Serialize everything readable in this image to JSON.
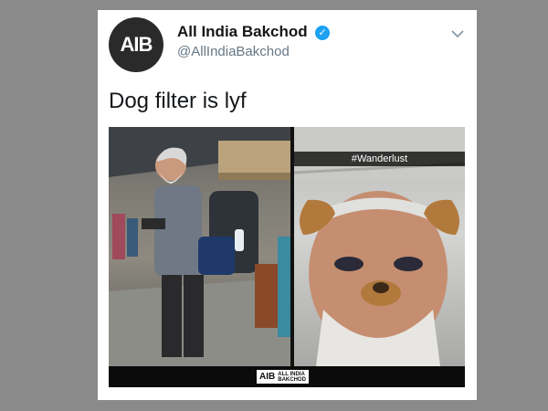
{
  "tweet": {
    "display_name": "All India Bakchod",
    "handle": "@AllIndiaBakchod",
    "text": "Dog filter is lyf",
    "avatar_label": "AIB",
    "verified_icon": "verified-badge-icon",
    "menu_icon": "chevron-down-icon"
  },
  "media": {
    "snap_caption": "#Wanderlust",
    "watermark_logo": "AIB",
    "watermark_text_line1": "ALL INDIA",
    "watermark_text_line2": "BAKCHOD"
  },
  "colors": {
    "page_bg": "#8a8a8a",
    "card_bg": "#ffffff",
    "verified": "#1da1f2",
    "handle": "#657786"
  }
}
